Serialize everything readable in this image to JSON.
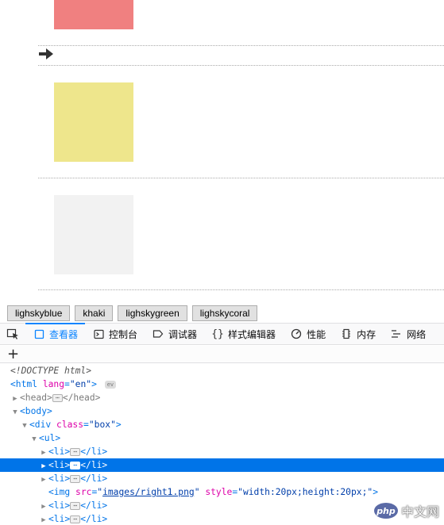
{
  "buttons": [
    "lighskyblue",
    "khaki",
    "lighskygreen",
    "lighskycoral"
  ],
  "devtools": {
    "tabs": [
      {
        "label": "查看器",
        "icon": "inspector-icon",
        "active": true
      },
      {
        "label": "控制台",
        "icon": "console-icon",
        "active": false
      },
      {
        "label": "调试器",
        "icon": "debugger-icon",
        "active": false
      },
      {
        "label": "样式编辑器",
        "icon": "style-editor-icon",
        "active": false
      },
      {
        "label": "性能",
        "icon": "performance-icon",
        "active": false
      },
      {
        "label": "内存",
        "icon": "memory-icon",
        "active": false
      },
      {
        "label": "网络",
        "icon": "network-icon",
        "active": false
      }
    ],
    "add_node": "+"
  },
  "tree": {
    "doctype": "<!DOCTYPE html>",
    "html_open": "<html",
    "html_attr_name": "lang",
    "html_attr_val": "\"en\"",
    "ev_badge": "ev",
    "head_open": "<head>",
    "head_close": "</head>",
    "body_open": "<body>",
    "div_open": "<div",
    "div_attr_name": "class",
    "div_attr_val": "\"box\"",
    "ul_open": "<ul>",
    "li_open": "<li>",
    "li_close": "</li>",
    "ellipsis": "⋯",
    "img_open": "<img",
    "img_src_name": "src",
    "img_src_val": "images/right1.png",
    "img_style_name": "style",
    "img_style_val": "\"width:20px;height:20px;\"",
    "img_close": ">"
  },
  "watermark": {
    "logo": "php",
    "text": "中文网"
  },
  "colors": {
    "coral": "#f08080",
    "khaki": "#eee68c",
    "light": "#f2f2f2",
    "accent": "#0a84ff",
    "selection": "#0074e8"
  }
}
